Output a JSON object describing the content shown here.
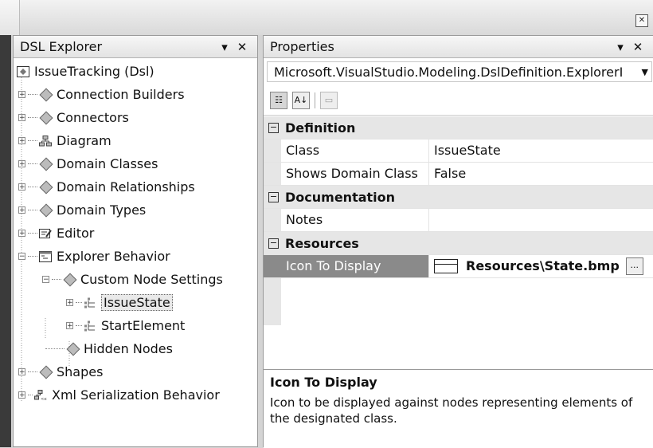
{
  "window": {
    "close_glyph": "✕"
  },
  "dsl_explorer": {
    "title": "DSL Explorer",
    "pin_glyph": "▾",
    "close_glyph": "✕",
    "root": "IssueTracking (Dsl)",
    "items": [
      {
        "label": "Connection Builders"
      },
      {
        "label": "Connectors"
      },
      {
        "label": "Diagram"
      },
      {
        "label": "Domain Classes"
      },
      {
        "label": "Domain Relationships"
      },
      {
        "label": "Domain Types"
      },
      {
        "label": "Editor"
      },
      {
        "label": "Explorer Behavior"
      },
      {
        "label": "Custom Node Settings"
      },
      {
        "label": "IssueState"
      },
      {
        "label": "StartElement"
      },
      {
        "label": "Hidden Nodes"
      },
      {
        "label": "Shapes"
      },
      {
        "label": "Xml Serialization Behavior"
      }
    ]
  },
  "properties": {
    "title": "Properties",
    "pin_glyph": "▾",
    "close_glyph": "✕",
    "object_selector": "Microsoft.VisualStudio.Modeling.DslDefinition.ExplorerI",
    "toolbar": {
      "categorized": "☷",
      "alphabetical": "A↓",
      "pages": "▭"
    },
    "categories": [
      {
        "name": "Definition",
        "props": [
          {
            "name": "Class",
            "value": "IssueState"
          },
          {
            "name": "Shows Domain Class",
            "value": "False"
          }
        ]
      },
      {
        "name": "Documentation",
        "props": [
          {
            "name": "Notes",
            "value": ""
          }
        ]
      },
      {
        "name": "Resources",
        "props": [
          {
            "name": "Icon To Display",
            "value": "Resources\\State.bmp"
          }
        ]
      }
    ],
    "ellipsis": "...",
    "description": {
      "title": "Icon To Display",
      "text": "Icon to be displayed against nodes representing elements of the designated class."
    }
  }
}
